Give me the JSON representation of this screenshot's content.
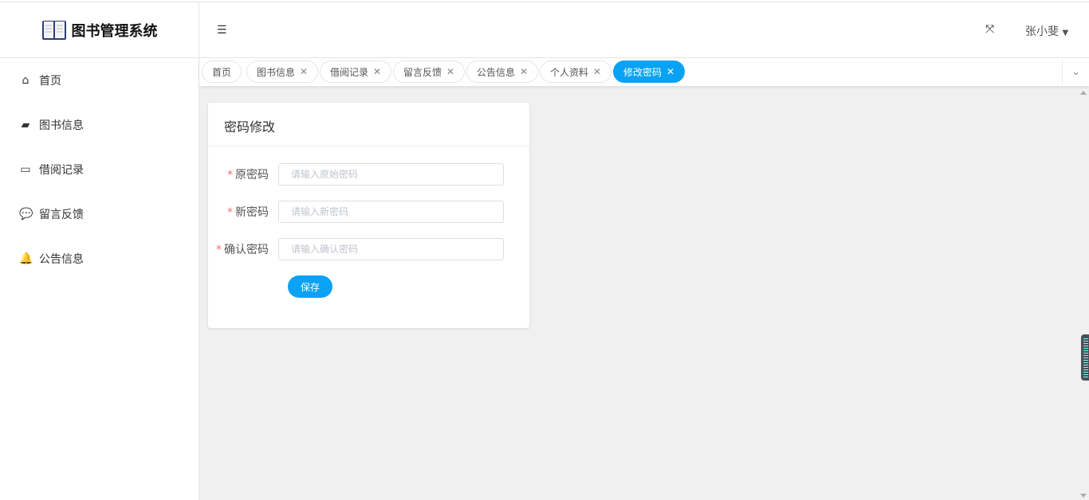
{
  "app": {
    "title": "图书管理系统"
  },
  "header": {
    "user_name": "张小斐"
  },
  "sidebar": {
    "items": [
      {
        "label": "首页",
        "icon": "home-icon"
      },
      {
        "label": "图书信息",
        "icon": "book-icon"
      },
      {
        "label": "借阅记录",
        "icon": "card-icon"
      },
      {
        "label": "留言反馈",
        "icon": "chat-icon"
      },
      {
        "label": "公告信息",
        "icon": "bell-icon"
      }
    ]
  },
  "tabs": [
    {
      "label": "首页"
    },
    {
      "label": "图书信息"
    },
    {
      "label": "借阅记录"
    },
    {
      "label": "留言反馈"
    },
    {
      "label": "公告信息"
    },
    {
      "label": "个人资料"
    },
    {
      "label": "修改密码",
      "active": true
    }
  ],
  "form": {
    "title": "密码修改",
    "fields": [
      {
        "label": "原密码",
        "placeholder": "请输入原始密码",
        "value": ""
      },
      {
        "label": "新密码",
        "placeholder": "请输入新密码",
        "value": ""
      },
      {
        "label": "确认密码",
        "placeholder": "请输入确认密码",
        "value": ""
      }
    ],
    "required_mark": "*",
    "save_label": "保存"
  },
  "colors": {
    "accent": "#0aa2f5",
    "required": "#f56c6c",
    "background": "#f0f0f0"
  }
}
